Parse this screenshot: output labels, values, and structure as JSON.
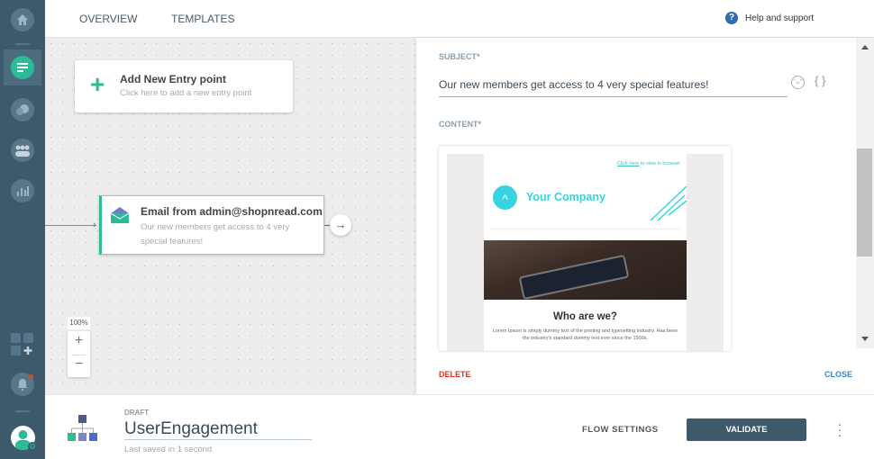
{
  "topbar": {
    "tabs": [
      {
        "label": "OVERVIEW"
      },
      {
        "label": "TEMPLATES"
      }
    ],
    "help": "Help and support"
  },
  "canvas": {
    "entry": {
      "title": "Add New Entry point",
      "subtitle": "Click here to add a new entry point"
    },
    "email_node": {
      "title": "Email from admin@shopnread.com",
      "subtitle": "Our new members get access to 4 very special features!"
    },
    "zoom": {
      "level": "100%",
      "plus": "+",
      "minus": "−"
    }
  },
  "panel": {
    "subject_label": "SUBJECT*",
    "subject_value": "Our new members get access to 4 very special features!",
    "content_label": "CONTENT*",
    "preview": {
      "view_link": "Click here",
      "view_text": " to view in browser",
      "company": "Your Company",
      "heading": "Who are we?",
      "body": "Lorem Ipsum is simply dummy text of the printing and typesetting industry. Has been the industry's standard dummy text ever since the 1500s."
    },
    "delete": "DELETE",
    "close": "CLOSE"
  },
  "bottombar": {
    "status": "DRAFT",
    "flow_name": "UserEngagement",
    "saved": "Last saved in 1 second",
    "flow_settings": "FLOW SETTINGS",
    "validate": "VALIDATE"
  },
  "colors": {
    "sidebar": "#3d5a6c",
    "accent": "#2bbb97",
    "validate": "#3d5a6c",
    "delete": "#d0362c",
    "close": "#3b86c6",
    "brand": "#37d3e0"
  }
}
